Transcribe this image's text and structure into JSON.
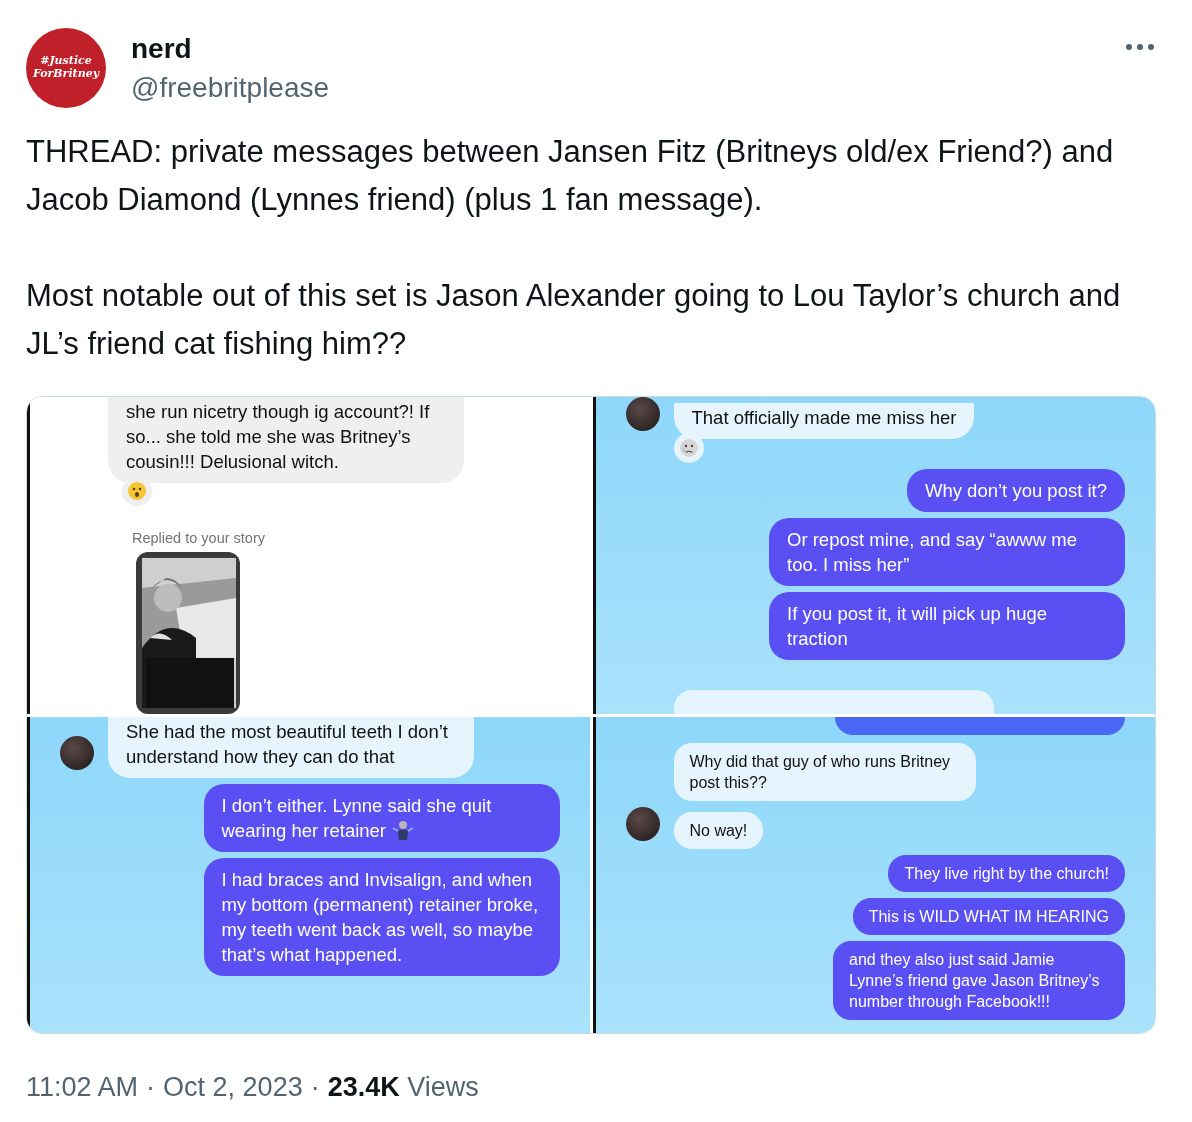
{
  "author": {
    "avatar_lines": [
      "#Justice",
      "ForBritney"
    ],
    "name": "nerd",
    "handle": "@freebritplease"
  },
  "paragraphs": [
    "THREAD: private messages between Jansen Fitz (Britneys old/ex Friend?) and Jacob Diamond (Lynnes friend) (plus 1 fan message).",
    "Most notable out of this set is Jason Alexander going to Lou Taylor’s church and JL’s friend cat fishing him??"
  ],
  "panels": [
    {
      "messages": [
        {
          "kind": "incoming",
          "text": "she run nicetry though ig account?! If so... she told me she was Britney’s cousin!!! Delusional witch.",
          "avatar": false
        },
        {
          "kind": "surprised_reaction"
        },
        {
          "kind": "label",
          "text": "Replied to your story"
        },
        {
          "kind": "story"
        }
      ]
    },
    {
      "messages": [
        {
          "kind": "incoming",
          "text": "That officially made me miss her",
          "avatar": true
        },
        {
          "kind": "crying_reaction"
        },
        {
          "kind": "outgoing",
          "text": "Why don’t you post it?"
        },
        {
          "kind": "outgoing",
          "text": "Or repost mine, and say “awww me too. I miss her”"
        },
        {
          "kind": "outgoing",
          "text": "If you post it, it will pick up huge traction"
        },
        {
          "kind": "partial_incoming"
        }
      ]
    },
    {
      "messages": [
        {
          "kind": "incoming",
          "text": "She had the most beautiful teeth I don’t understand how they can do that",
          "avatar": true
        },
        {
          "kind": "outgoing_shrug",
          "text": "I don’t either. Lynne said she quit wearing her retainer"
        },
        {
          "kind": "outgoing",
          "text": "I had braces and Invisalign, and when my bottom (permanent) retainer broke, my teeth went back as well, so maybe that’s what happened."
        }
      ]
    },
    {
      "messages": [
        {
          "kind": "partial_outgoing"
        },
        {
          "kind": "incoming",
          "text": "Why did that guy of who runs Britney post this??",
          "avatar": false
        },
        {
          "kind": "incoming",
          "text": "No way!",
          "avatar": true
        },
        {
          "kind": "outgoing",
          "text": "They live right by the church!"
        },
        {
          "kind": "outgoing",
          "text": "This is WILD WHAT IM HEARING"
        },
        {
          "kind": "outgoing",
          "text": "and they also just said Jamie Lynne’s friend gave Jason Britney’s number through Facebook!!!"
        }
      ]
    }
  ],
  "footer": {
    "time": "11:02 AM",
    "separators": [
      "·",
      "·"
    ],
    "date": "Oct 2, 2023",
    "views_count": "23.4K",
    "views_label": "Views"
  }
}
